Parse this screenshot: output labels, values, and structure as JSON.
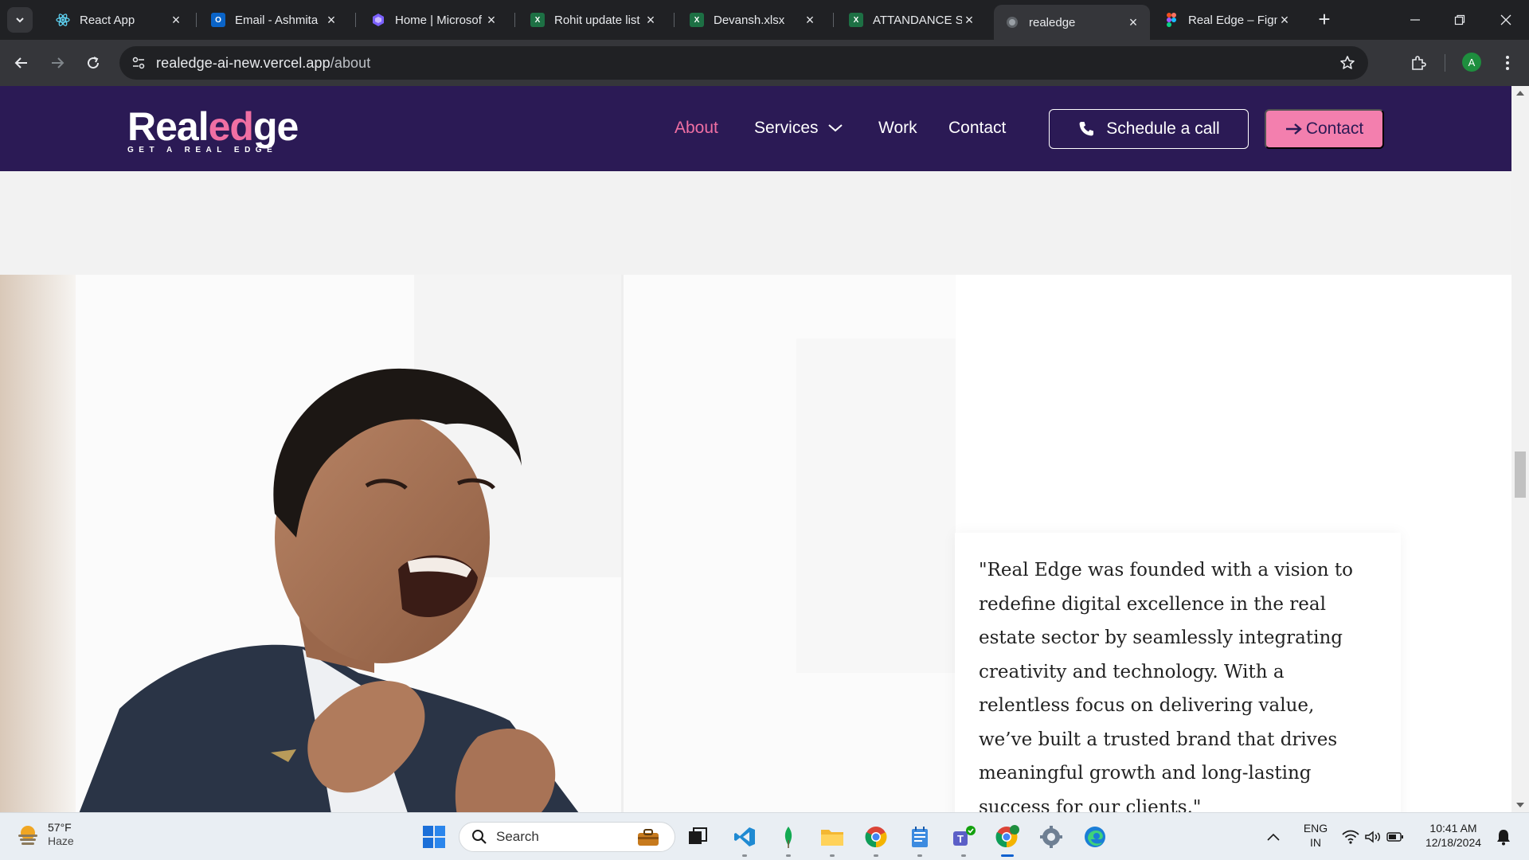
{
  "browser": {
    "tabs": [
      {
        "title": "React App",
        "icon": "react-icon",
        "color": "#61dafb"
      },
      {
        "title": "Email - Ashmita",
        "icon": "outlook-icon",
        "color": "#0a64c8"
      },
      {
        "title": "Home | Microsof",
        "icon": "copilot-icon",
        "color": "#7b61ff"
      },
      {
        "title": "Rohit update list",
        "icon": "excel-icon",
        "color": "#1d7044"
      },
      {
        "title": "Devansh.xlsx",
        "icon": "excel-icon",
        "color": "#1d7044"
      },
      {
        "title": "ATTANDANCE SI",
        "icon": "excel-icon",
        "color": "#1d7044"
      },
      {
        "title": "realedge",
        "icon": "globe-icon",
        "color": "#9aa0a6"
      },
      {
        "title": "Real Edge – Figm",
        "icon": "figma-icon",
        "color": "#f24e1e"
      }
    ],
    "active_tab_index": 6,
    "url_host": "realedge-ai-new.vercel.app",
    "url_path": "/about",
    "profile_initial": "A"
  },
  "site": {
    "logo_main": "Real",
    "logo_accent": "ed",
    "logo_end": "ge",
    "logo_tagline": "GET A REAL EDGE",
    "nav": {
      "about": "About",
      "services": "Services",
      "work": "Work",
      "contact": "Contact"
    },
    "schedule_label": "Schedule a call",
    "contact_label": "Contact",
    "colors": {
      "header_bg": "#2b1a55",
      "accent_pink": "#f06fa3",
      "contact_btn": "#f37fae"
    }
  },
  "about": {
    "quote": "\"Real Edge was founded with a vision to redefine digital excellence in the real estate sector by seamlessly integrating creativity and technology. With a relentless focus on delivering value, we’ve built a trusted brand that drives meaningful growth and long-lasting success for our clients.\""
  },
  "taskbar": {
    "weather_temp": "57°F",
    "weather_cond": "Haze",
    "search_label": "Search",
    "lang_top": "ENG",
    "lang_bottom": "IN",
    "time": "10:41 AM",
    "date": "12/18/2024"
  }
}
